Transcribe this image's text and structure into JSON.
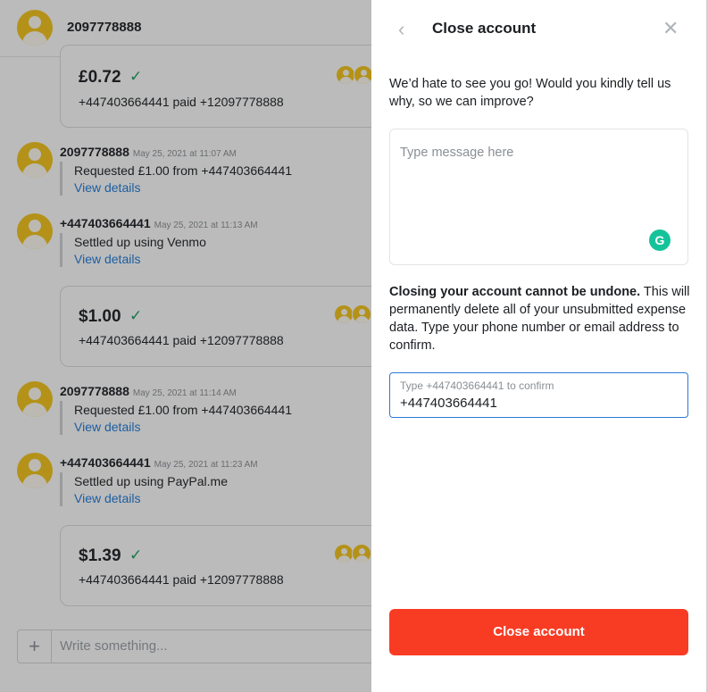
{
  "chat": {
    "header_title": "2097778888",
    "cards": [
      {
        "amount": "£0.72",
        "paid_text": "+447403664441 paid +12097778888"
      },
      {
        "amount": "$1.00",
        "paid_text": "+447403664441 paid +12097778888"
      },
      {
        "amount": "$1.39",
        "paid_text": "+447403664441 paid +12097778888"
      }
    ],
    "messages": [
      {
        "sender": "2097778888",
        "timestamp": "May 25, 2021 at 11:07 AM",
        "text": "Requested £1.00 from +447403664441",
        "link": "View details"
      },
      {
        "sender": "+447403664441",
        "timestamp": "May 25, 2021 at 11:13 AM",
        "text": "Settled up using Venmo",
        "link": "View details"
      },
      {
        "sender": "2097778888",
        "timestamp": "May 25, 2021 at 11:14 AM",
        "text": "Requested £1.00 from +447403664441",
        "link": "View details"
      },
      {
        "sender": "+447403664441",
        "timestamp": "May 25, 2021 at 11:23 AM",
        "text": "Settled up using PayPal.me",
        "link": "View details"
      }
    ],
    "composer_placeholder": "Write something..."
  },
  "panel": {
    "title": "Close account",
    "intro": "We’d hate to see you go! Would you kindly tell us why, so we can improve?",
    "message_placeholder": "Type message here",
    "warning_bold": "Closing your account cannot be undone.",
    "warning_rest": " This will permanently delete all of your unsubmitted expense data. Type your phone number or email address to confirm.",
    "confirm_label": "Type +447403664441 to confirm",
    "confirm_value": "+447403664441",
    "close_button": "Close account"
  },
  "colors": {
    "accent_danger": "#f83c24",
    "link": "#1d7ad8",
    "avatar": "#f5c518",
    "check": "#1a9e5a",
    "grammarly": "#15c39a"
  },
  "icons": [
    "avatar-icon",
    "check-icon",
    "back-chevron-icon",
    "close-icon",
    "plus-icon",
    "grammarly-icon"
  ]
}
